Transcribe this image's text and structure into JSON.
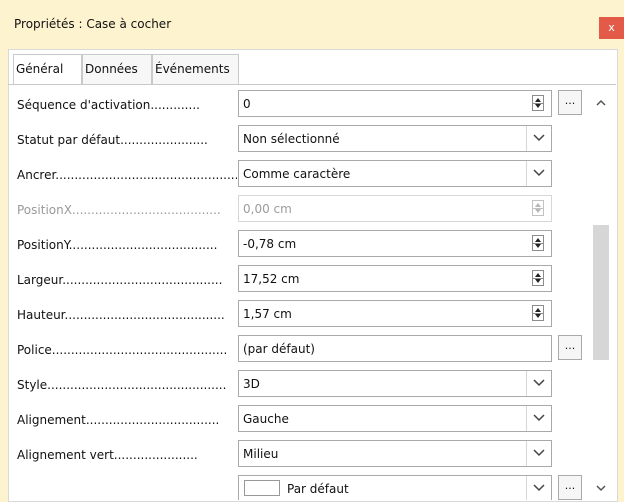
{
  "window": {
    "title": "Propriétés : Case à cocher",
    "close_label": "x"
  },
  "tabs": [
    {
      "label": "Général",
      "active": true
    },
    {
      "label": "Données",
      "active": false
    },
    {
      "label": "Événements",
      "active": false
    }
  ],
  "properties": [
    {
      "label": "Séquence d'activation.............",
      "value": "0",
      "control": "spin",
      "browse": "..."
    },
    {
      "label": "Statut par défaut.......................",
      "value": "Non sélectionné",
      "control": "dropdown"
    },
    {
      "label": "Ancrer.................................................",
      "value": "Comme caractère",
      "control": "dropdown"
    },
    {
      "label": "PositionX.......................................",
      "value": "0,00 cm",
      "control": "spin",
      "disabled": true
    },
    {
      "label": "PositionY.......................................",
      "value": "-0,78 cm",
      "control": "spin"
    },
    {
      "label": "Largeur..........................................",
      "value": "17,52 cm",
      "control": "spin"
    },
    {
      "label": "Hauteur..........................................",
      "value": "1,57 cm",
      "control": "spin"
    },
    {
      "label": "Police..............................................",
      "value": "(par défaut)",
      "control": "text",
      "browse": "..."
    },
    {
      "label": "Style...............................................",
      "value": "3D",
      "control": "dropdown"
    },
    {
      "label": "Alignement...................................",
      "value": "Gauche",
      "control": "dropdown"
    },
    {
      "label": "Alignement vert......................",
      "value": "Milieu",
      "control": "dropdown"
    },
    {
      "label": "",
      "value": "Par défaut",
      "control": "dropdown",
      "partial": true,
      "browse": "..."
    }
  ],
  "colors": {
    "window_bg": "#fdf3cf",
    "close_bg": "#e35a49",
    "panel_bg": "#ffffff",
    "scroll_thumb": "#d6d6d6"
  },
  "icons": {
    "close": "close-icon",
    "spin": "spin-button-icon",
    "dropdown": "chevron-down-icon",
    "scroll_up": "chevron-up-icon",
    "scroll_down": "chevron-down-icon"
  }
}
